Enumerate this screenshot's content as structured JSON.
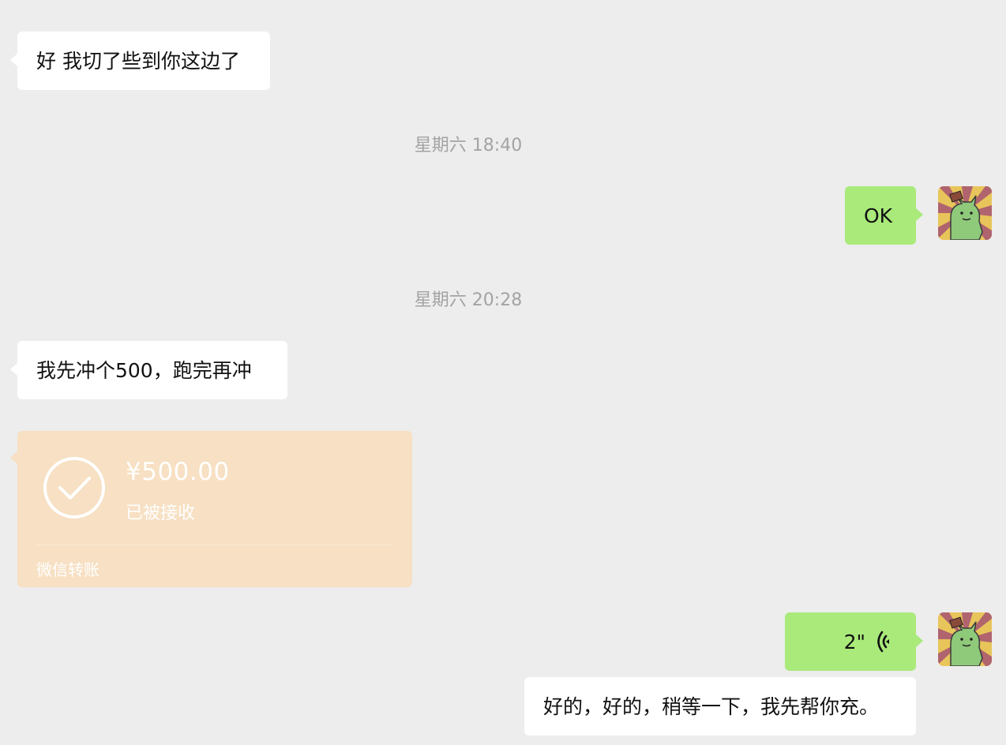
{
  "messages": {
    "msg1": "好 我切了些到你这边了",
    "time1": "星期六 18:40",
    "msg2": "OK",
    "time2": "星期六 20:28",
    "msg3": "我先冲个500，跑完再冲",
    "transfer": {
      "amount": "¥500.00",
      "status": "已被接收",
      "label": "微信转账"
    },
    "voice_duration": "2\"",
    "msg4": "好的，好的，稍等一下，我先帮你充。"
  },
  "icons": {
    "check": "check-circle-icon",
    "voice": "voice-wave-icon",
    "avatar": "cat-avatar"
  },
  "colors": {
    "background": "#ededed",
    "incoming_bubble": "#ffffff",
    "outgoing_bubble": "#a9ea7a",
    "transfer_card": "#f7e0c3"
  }
}
